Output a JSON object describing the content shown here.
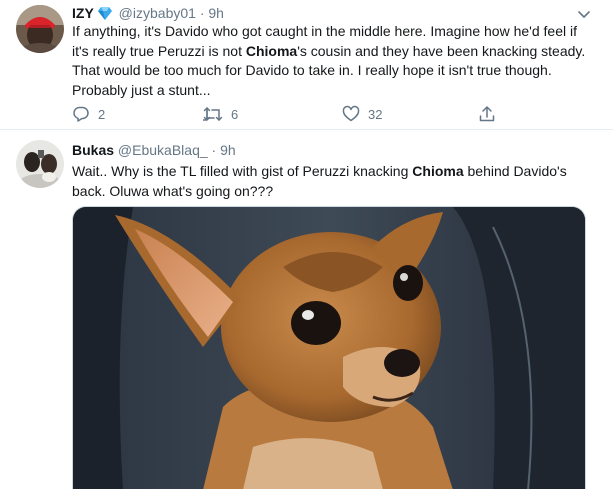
{
  "tweets": [
    {
      "name": "IZY",
      "verified_emoji": "💎",
      "handle": "@izybaby01",
      "separator": "·",
      "time": "9h",
      "text_parts": [
        "If anything, it's Davido who got caught in the middle here. Imagine how he'd feel if it's really true Peruzzi is not ",
        "Chioma",
        "'s cousin and they have been knacking steady. That would be too much for Davido to take in. I really hope it isn't true though. Probably just a stunt..."
      ],
      "actions": {
        "reply_count": "2",
        "retweet_count": "6",
        "like_count": "32"
      }
    },
    {
      "name": "Bukas",
      "handle": "@EbukaBlaq_",
      "separator": "·",
      "time": "9h",
      "text_parts": [
        "Wait.. Why is the TL filled with gist of Peruzzi knacking ",
        "Chioma",
        " behind Davido's back. Oluwa what's going on???"
      ]
    }
  ],
  "colors": {
    "text": "#14171a",
    "secondary": "#657786",
    "border": "#e6ecf0",
    "verified_gem": "#3ba9ee"
  },
  "icons": [
    "reply-icon",
    "retweet-icon",
    "like-icon",
    "share-icon",
    "chevron-down-icon",
    "diamond-emoji-icon"
  ]
}
